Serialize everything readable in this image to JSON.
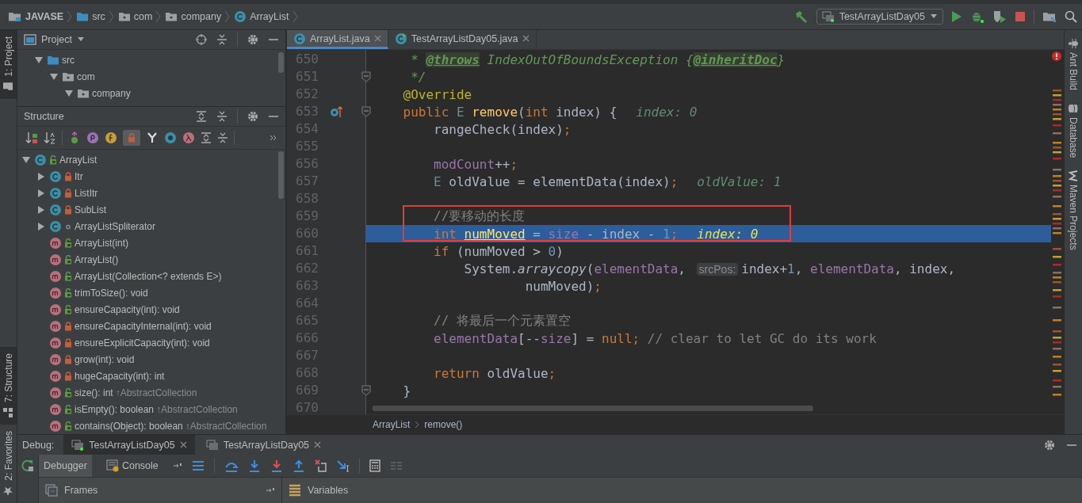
{
  "nav_bar": {
    "breadcrumbs": [
      {
        "label": "JAVASE",
        "kind": "project"
      },
      {
        "label": "src",
        "kind": "source"
      },
      {
        "label": "com",
        "kind": "package"
      },
      {
        "label": "company",
        "kind": "package"
      },
      {
        "label": "ArrayList",
        "kind": "class"
      }
    ],
    "run_config": "TestArrayListDay05"
  },
  "left_strip": {
    "tabs": [
      {
        "label": "1: Project",
        "selected": true,
        "kind": "top"
      },
      {
        "label": "7: Structure",
        "selected": true,
        "kind": "bottom"
      },
      {
        "label": "2: Favorites",
        "selected": false,
        "kind": "bottom"
      }
    ]
  },
  "project_panel": {
    "title": "Project",
    "tree": [
      {
        "label": "src",
        "kind": "source",
        "expanded": true,
        "children": [
          {
            "label": "com",
            "kind": "package",
            "expanded": true,
            "children": [
              {
                "label": "company",
                "kind": "package",
                "expanded": true
              }
            ]
          }
        ]
      }
    ]
  },
  "structure_panel": {
    "title": "Structure",
    "tree": [
      {
        "label": "ArrayList",
        "kind": "public_class",
        "expanded": true,
        "children": [
          {
            "label": "Itr",
            "kind": "private_class",
            "expanded": false
          },
          {
            "label": "ListItr",
            "kind": "private_class",
            "expanded": false
          },
          {
            "label": "SubList",
            "kind": "private_class",
            "expanded": false
          },
          {
            "label": "ArrayListSpliterator",
            "kind": "package_class",
            "expanded": false
          },
          {
            "label": "ArrayList(int)",
            "kind": "public_method"
          },
          {
            "label": "ArrayList()",
            "kind": "public_method"
          },
          {
            "label": "ArrayList(Collection<? extends E>)",
            "kind": "public_method"
          },
          {
            "label": "trimToSize(): void",
            "kind": "public_method"
          },
          {
            "label": "ensureCapacity(int): void",
            "kind": "public_method"
          },
          {
            "label": "ensureCapacityInternal(int): void",
            "kind": "private_method"
          },
          {
            "label": "ensureExplicitCapacity(int): void",
            "kind": "private_method"
          },
          {
            "label": "grow(int): void",
            "kind": "private_method"
          },
          {
            "label": "hugeCapacity(int): int",
            "kind": "private_method"
          },
          {
            "label": "size(): int",
            "kind": "public_method",
            "inherited": "↑AbstractCollection"
          },
          {
            "label": "isEmpty(): boolean",
            "kind": "public_method",
            "inherited": "↑AbstractCollection"
          },
          {
            "label": "contains(Object): boolean",
            "kind": "public_method",
            "inherited": "↑AbstractCollection"
          }
        ]
      }
    ]
  },
  "editor": {
    "tabs": [
      {
        "label": "ArrayList.java",
        "selected": true,
        "kind": "class"
      },
      {
        "label": "TestArrayListDay05.java",
        "selected": false,
        "kind": "runnable"
      }
    ],
    "lines": [
      {
        "number": "650",
        "selected": false,
        "code": [
          {
            "text": "     * ",
            "kind": "doc"
          },
          {
            "text": "@throws",
            "kind": "doctag"
          },
          {
            "text": " IndexOutOfBoundsException {",
            "kind": "doc"
          },
          {
            "text": "@inheritDoc",
            "kind": "doctag"
          },
          {
            "text": "}",
            "kind": "doc"
          }
        ]
      },
      {
        "number": "651",
        "selected": false,
        "fold": true,
        "code": [
          {
            "text": "     */",
            "kind": "doc"
          }
        ]
      },
      {
        "number": "652",
        "selected": false,
        "code": [
          {
            "text": "    @Override",
            "kind": "annot"
          }
        ]
      },
      {
        "number": "653",
        "selected": false,
        "fold": true,
        "kind": "override",
        "code": [
          {
            "text": "    public ",
            "kind": "kw"
          },
          {
            "text": "E ",
            "kind": "type"
          },
          {
            "text": "remove",
            "kind": "method"
          },
          {
            "text": "(",
            "kind": "plain"
          },
          {
            "text": "int ",
            "kind": "kw"
          },
          {
            "text": "index) {",
            "kind": "plain"
          }
        ],
        "hint": "index: 0"
      },
      {
        "number": "654",
        "selected": false,
        "code": [
          {
            "text": "        rangeCheck(index)",
            "kind": "plain"
          },
          {
            "text": ";",
            "kind": "kw"
          }
        ]
      },
      {
        "number": "655",
        "selected": false
      },
      {
        "number": "656",
        "selected": false,
        "code": [
          {
            "text": "        modCount",
            "kind": "field"
          },
          {
            "text": "++",
            "kind": "plain"
          },
          {
            "text": ";",
            "kind": "kw"
          }
        ]
      },
      {
        "number": "657",
        "selected": false,
        "code": [
          {
            "text": "        E ",
            "kind": "type"
          },
          {
            "text": "oldValue = elementData(index)",
            "kind": "plain"
          },
          {
            "text": ";",
            "kind": "kw"
          }
        ],
        "hint": "oldValue: 1"
      },
      {
        "number": "658",
        "selected": false
      },
      {
        "number": "659",
        "selected": false,
        "code": [
          {
            "text": "        //要移动的长度",
            "kind": "comment"
          }
        ]
      },
      {
        "number": "660",
        "selected": true,
        "code": [
          {
            "text": "        int ",
            "kind": "kw"
          },
          {
            "text": "numMoved",
            "kind": "var"
          },
          {
            "text": " = ",
            "kind": "plain"
          },
          {
            "text": "size",
            "kind": "field"
          },
          {
            "text": " - index - ",
            "kind": "plain"
          },
          {
            "text": "1",
            "kind": "num"
          },
          {
            "text": ";",
            "kind": "kw"
          }
        ],
        "hint": "index: 0"
      },
      {
        "number": "661",
        "selected": false,
        "code": [
          {
            "text": "        if",
            "kind": "kw"
          },
          {
            "text": " (numMoved > ",
            "kind": "plain"
          },
          {
            "text": "0",
            "kind": "num"
          },
          {
            "text": ")",
            "kind": "plain"
          }
        ]
      },
      {
        "number": "662",
        "selected": false,
        "code": [
          {
            "text": "            System.",
            "kind": "plain"
          },
          {
            "text": "arraycopy",
            "kind": "static"
          },
          {
            "text": "(",
            "kind": "plain"
          },
          {
            "text": "elementData",
            "kind": "field"
          },
          {
            "text": ", ",
            "kind": "plain"
          },
          {
            "text": "srcPos:",
            "kind": "param"
          },
          {
            "text": "index+",
            "kind": "plain"
          },
          {
            "text": "1",
            "kind": "num"
          },
          {
            "text": ", ",
            "kind": "plain"
          },
          {
            "text": "elementData",
            "kind": "field"
          },
          {
            "text": ", index,",
            "kind": "plain"
          }
        ]
      },
      {
        "number": "663",
        "selected": false,
        "code": [
          {
            "text": "                    numMoved)",
            "kind": "plain"
          },
          {
            "text": ";",
            "kind": "kw"
          }
        ]
      },
      {
        "number": "664",
        "selected": false
      },
      {
        "number": "665",
        "selected": false,
        "code": [
          {
            "text": "        // 将最后一个元素置空",
            "kind": "comment"
          }
        ]
      },
      {
        "number": "666",
        "selected": false,
        "code": [
          {
            "text": "        elementData",
            "kind": "field"
          },
          {
            "text": "[--",
            "kind": "plain"
          },
          {
            "text": "size",
            "kind": "field"
          },
          {
            "text": "] = ",
            "kind": "plain"
          },
          {
            "text": "null",
            "kind": "kw"
          },
          {
            "text": ";",
            "kind": "kw"
          },
          {
            "text": " // clear to let GC do its work",
            "kind": "comment"
          }
        ]
      },
      {
        "number": "667",
        "selected": false
      },
      {
        "number": "668",
        "selected": false,
        "code": [
          {
            "text": "        return ",
            "kind": "kw"
          },
          {
            "text": "oldValue",
            "kind": "plain"
          },
          {
            "text": ";",
            "kind": "kw"
          }
        ]
      },
      {
        "number": "669",
        "selected": false,
        "fold": true,
        "code": [
          {
            "text": "    }",
            "kind": "plain"
          }
        ]
      },
      {
        "number": "670",
        "selected": false
      }
    ],
    "breadcrumbs": [
      "ArrayList",
      "remove()"
    ]
  },
  "right_strip": {
    "tabs": [
      {
        "label": "Ant Build",
        "kind": "ant"
      },
      {
        "label": "Database",
        "kind": "database"
      },
      {
        "label": "Maven Projects",
        "kind": "maven"
      }
    ]
  },
  "debug_panel": {
    "title": "Debug:",
    "sessions": [
      {
        "label": "TestArrayListDay05",
        "selected": true
      },
      {
        "label": "TestArrayListDay05",
        "selected": false
      }
    ],
    "tabs": [
      {
        "label": "Debugger",
        "selected": true
      },
      {
        "label": "Console",
        "selected": false
      }
    ],
    "frames_title": "Frames",
    "variables_title": "Variables"
  }
}
